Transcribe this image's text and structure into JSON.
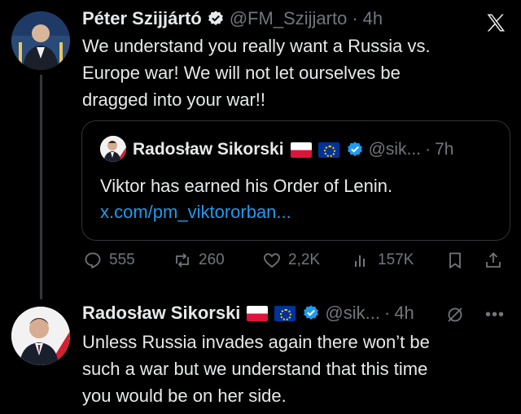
{
  "tweet1": {
    "name": "Péter Szijjártó",
    "handle": "@FM_Szijjarto",
    "time": "4h",
    "lines": [
      "We understand you really want a Russia vs.",
      "Europe war! We will not let ourselves be",
      "dragged into your war!!"
    ]
  },
  "quote": {
    "name": "Radosław Sikorski",
    "handle": "@sik...",
    "time": "7h",
    "text": "Viktor has earned his Order of Lenin.",
    "link": "x.com/pm_viktororban..."
  },
  "actions": {
    "replies": "555",
    "reposts": "260",
    "likes": "2,2K",
    "views": "157K"
  },
  "tweet2": {
    "name": "Radosław Sikorski",
    "handle": "@sik...",
    "time": "4h",
    "lines": [
      "Unless Russia invades again there won’t be",
      "such a war but we understand that this time",
      "you would be on her side."
    ]
  },
  "sep": "·",
  "icons": {
    "verified": "verified-badge-icon",
    "logo": "x-logo-icon"
  },
  "colors": {
    "background": "#000000",
    "text": "#e7e9ea",
    "muted": "#71767b",
    "link": "#1d9bf0",
    "verified": "#1d9bf0"
  }
}
